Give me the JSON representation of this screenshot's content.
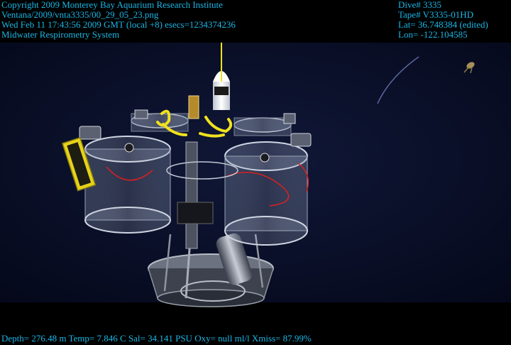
{
  "overlay": {
    "left_lines": [
      "Copyright 2009 Monterey Bay Aquarium Research Institute",
      "Ventana/2009/vnta3335/00_29_05_23.png",
      "Wed Feb 11 17:43:56 2009 GMT (local +8)  esecs=1234374236",
      "Midwater Respirometry System"
    ],
    "right_lines": [
      "Dive# 3335",
      "Tape# V3335-01HD",
      "Lat= 36.748384 (edited)",
      "Lon= -122.104585"
    ],
    "bottom_line": "Depth= 276.48 m  Temp= 7.846 C  Sal= 34.141 PSU  Oxy= null ml/l  Xmiss= 87.99%"
  },
  "colors": {
    "overlay_text": "#1ab7e6",
    "background": "#000000",
    "water": "#0a0f28",
    "cable_yellow": "#f0e11e",
    "frame_yellow": "#e6d21a",
    "cable_red": "#d82020"
  }
}
